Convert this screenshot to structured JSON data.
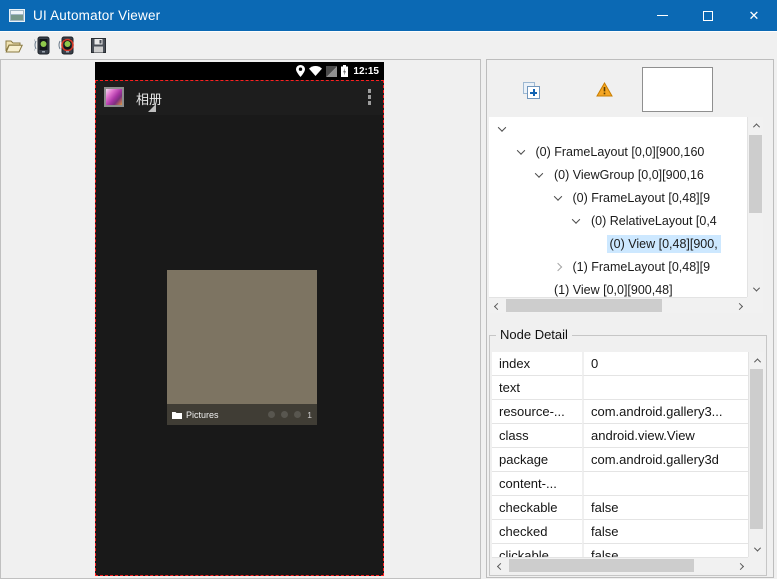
{
  "window": {
    "title": "UI Automator Viewer"
  },
  "titlebar_controls": {
    "minimize": "minimize",
    "maximize": "maximize",
    "close": "✕"
  },
  "toolbar": {
    "buttons": [
      {
        "name": "open-file"
      },
      {
        "name": "device-screenshot"
      },
      {
        "name": "device-screenshot-compressed"
      },
      {
        "name": "save-screenshot"
      }
    ]
  },
  "device_screen": {
    "status_bar": {
      "time": "12:15"
    },
    "action_bar": {
      "app_title": "相册"
    },
    "album": {
      "name": "Pictures",
      "count": "1"
    }
  },
  "tree_panel": {
    "rows": [
      {
        "level": 0,
        "expander": "expanded",
        "label": "",
        "selected": false
      },
      {
        "level": 1,
        "expander": "expanded",
        "label": "(0) FrameLayout [0,0][900,160",
        "selected": false
      },
      {
        "level": 2,
        "expander": "expanded",
        "label": "(0) ViewGroup [0,0][900,16",
        "selected": false
      },
      {
        "level": 3,
        "expander": "expanded",
        "label": "(0) FrameLayout [0,48][9",
        "selected": false
      },
      {
        "level": 4,
        "expander": "expanded",
        "label": "(0) RelativeLayout [0,4",
        "selected": false
      },
      {
        "level": 5,
        "expander": "none",
        "label": "(0) View [0,48][900,",
        "selected": true
      },
      {
        "level": 3,
        "expander": "collapsed",
        "label": "(1) FrameLayout [0,48][9",
        "selected": false
      },
      {
        "level": 2,
        "expander": "none",
        "label": "(1) View [0,0][900,48]",
        "selected": false
      }
    ]
  },
  "node_detail": {
    "title": "Node Detail",
    "rows": [
      {
        "name": "index",
        "value": "0"
      },
      {
        "name": "text",
        "value": ""
      },
      {
        "name": "resource-...",
        "value": "com.android.gallery3..."
      },
      {
        "name": "class",
        "value": "android.view.View"
      },
      {
        "name": "package",
        "value": "com.android.gallery3d"
      },
      {
        "name": "content-...",
        "value": ""
      },
      {
        "name": "checkable",
        "value": "false"
      },
      {
        "name": "checked",
        "value": "false"
      },
      {
        "name": "clickable",
        "value": "false"
      }
    ]
  },
  "colors": {
    "titlebar": "#0b69b4",
    "tree_selection": "#cde8ff",
    "highlight_border": "#ff2020",
    "album_fill": "#7d7462",
    "warning": "#f5a623"
  }
}
